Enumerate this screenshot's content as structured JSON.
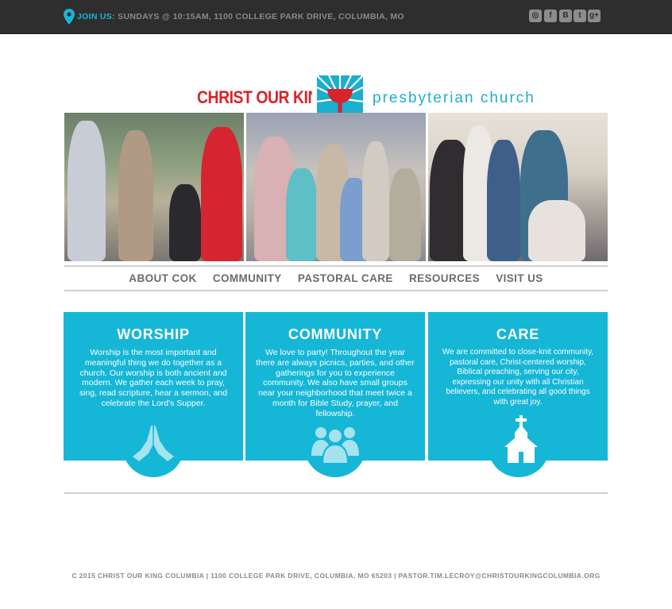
{
  "topbar": {
    "join_label": "JOIN US:",
    "join_text": "SUNDAYS @ 10:15AM, 1100 COLLEGE PARK DRIVE, COLUMBIA, MO",
    "social_icons": [
      "instagram-icon",
      "facebook-icon",
      "blogger-icon",
      "twitter-icon",
      "google-plus-icon"
    ]
  },
  "logo": {
    "left_text": "CHRIST OUR KING",
    "right_text": "presbyterian church"
  },
  "nav": {
    "items": [
      "ABOUT COK",
      "COMMUNITY",
      "PASTORAL CARE",
      "RESOURCES",
      "VISIT US"
    ]
  },
  "cards": [
    {
      "title": "WORSHIP",
      "text": "Worship is the most important and meaningful thing we do together as a church. Our worship is both ancient and modern. We gather each week to pray, sing, read scripture, hear a sermon, and celebrate the Lord's Supper.",
      "icon": "praying-hands-icon"
    },
    {
      "title": "COMMUNITY",
      "text": "We  love to party! Throughout the year there are always picnics, parties, and other gatherings for you to experience community.  We also have small groups near your neighborhood that meet twice a month for Bible Study, prayer, and fellowship.",
      "icon": "people-group-icon"
    },
    {
      "title": "CARE",
      "text": "We are committed to close-knit community, pastoral care, Christ-centered worship, Biblical preaching, serving our city, expressing our unity with all Christian believers, and celebrating all good things with great joy.",
      "icon": "church-icon"
    }
  ],
  "footer": {
    "text": "C 2015 CHRIST OUR KING COLUMBIA | 1100 COLLEGE PARK DRIVE, COLUMBIA, MO 65203 | PASTOR.TIM.LECROY@CHRISTOURKINGCOLUMBIA.ORG"
  },
  "colors": {
    "accent": "#16b6d6",
    "logo_red": "#d8232a",
    "topbar": "#2e2e2e"
  }
}
